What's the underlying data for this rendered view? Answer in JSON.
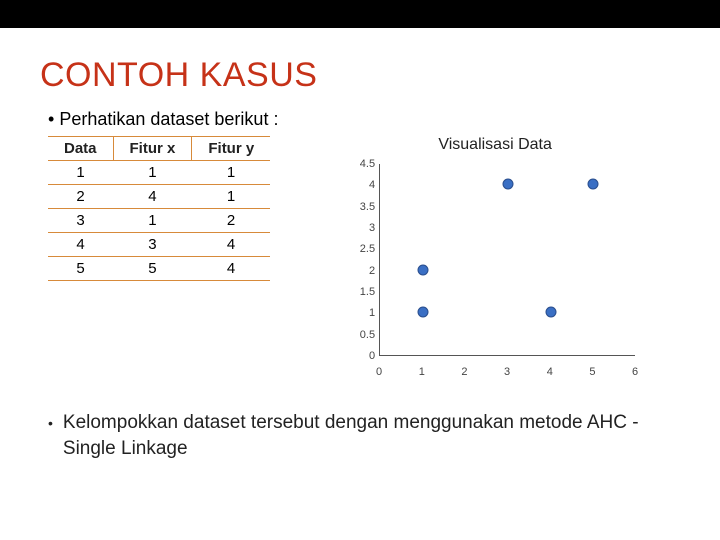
{
  "title": "CONTOH KASUS",
  "intro_prefix": "• ",
  "intro": "Perhatikan dataset berikut :",
  "table": {
    "headers": [
      "Data",
      "Fitur x",
      "Fitur y"
    ],
    "rows": [
      [
        "1",
        "1",
        "1"
      ],
      [
        "2",
        "4",
        "1"
      ],
      [
        "3",
        "1",
        "2"
      ],
      [
        "4",
        "3",
        "4"
      ],
      [
        "5",
        "5",
        "4"
      ]
    ]
  },
  "chart_title": "Visualisasi Data",
  "bullet_marker": "•",
  "bullet_text": "Kelompokkan dataset tersebut dengan menggunakan metode AHC - Single Linkage",
  "chart_data": {
    "type": "scatter",
    "title": "Visualisasi Data",
    "xlabel": "",
    "ylabel": "",
    "x": [
      1,
      4,
      1,
      3,
      5
    ],
    "y": [
      1,
      1,
      2,
      4,
      4
    ],
    "xlim": [
      0,
      6
    ],
    "ylim": [
      0,
      4.5
    ],
    "xticks": [
      0,
      1,
      2,
      3,
      4,
      5,
      6
    ],
    "yticks": [
      0,
      0.5,
      1,
      1.5,
      2,
      2.5,
      3,
      3.5,
      4,
      4.5
    ]
  }
}
